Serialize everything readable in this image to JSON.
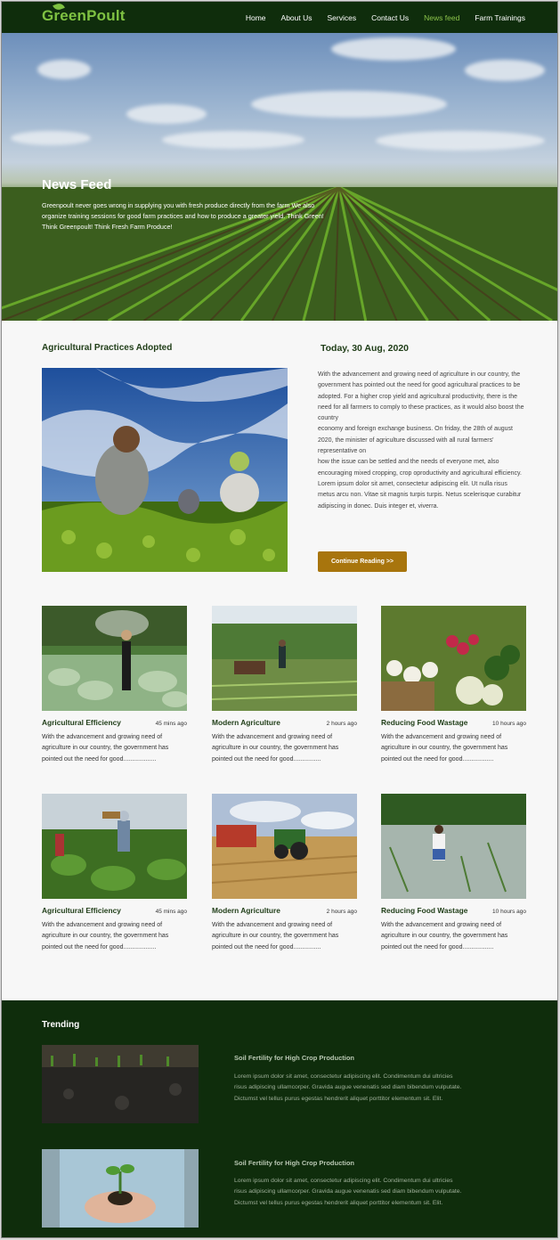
{
  "brand": {
    "name": "GreenPoult"
  },
  "nav": {
    "items": [
      "Home",
      "About Us",
      "Services",
      "Contact Us",
      "News feed",
      "Farm Trainings"
    ],
    "active": "News feed"
  },
  "hero": {
    "title": "News Feed",
    "text": "Greenpoult never goes wrong in supplying you with fresh produce directly from the farm We also organize training sessions for good farm practices and how to produce a greater yield.  Think Green! Think Greenpoult! Think Fresh Farm Produce!"
  },
  "featured": {
    "heading": "Agricultural Practices Adopted",
    "date": "Today, 30 Aug, 2020",
    "paragraphs": [
      "With the advancement and growing need of agriculture in our country, the government has pointed out the need for good agricultural practices to be",
      "adopted. For a higher crop yield and agricultural productivity, there is the need for all farmers to comply to these practices, as it would also boost the country",
      "economy and foreign exchange business. On friday, the 28th of august 2020, the minister of agriculture discussed with all rural farmers' representative on",
      "how the  issue can be settled and the needs of everyone met, also encouraging mixed cropping, crop oproductivity and agricultural efficiency.",
      "Lorem ipsum dolor sit amet, consectetur adipiscing elit. Ut nulla risus metus arcu non. Vitae sit magnis turpis turpis. Netus scelerisque curabitur adipiscing in donec. Duis integer et, viverra."
    ],
    "button": "Continue Reading >>"
  },
  "cards": [
    {
      "title": "Agricultural Efficiency",
      "time": "45 mins ago",
      "desc": "With the advancement and growing need of agriculture in our country, the government has pointed out the need for good..................."
    },
    {
      "title": "Modern Agriculture",
      "time": "2 hours ago",
      "desc": "With the advancement and growing need of agriculture in our country, the government has pointed out the need for good................"
    },
    {
      "title": "Reducing Food Wastage",
      "time": "10 hours ago",
      "desc": "With the advancement and growing need of agriculture in our country, the government has pointed out the need for good.................."
    },
    {
      "title": "Agricultural Efficiency",
      "time": "45 mins ago",
      "desc": "With the advancement and growing need of agriculture in our country, the government has pointed out the need for good..................."
    },
    {
      "title": "Modern Agriculture",
      "time": "2 hours ago",
      "desc": "With the advancement and growing need of agriculture in our country, the government has pointed out the need for good................"
    },
    {
      "title": "Reducing Food Wastage",
      "time": "10 hours ago",
      "desc": "With the advancement and growing need of agriculture in our country, the government has pointed out the need for good.................."
    }
  ],
  "trending": {
    "heading": "Trending",
    "items": [
      {
        "title": "Soil Fertility for High Crop Production",
        "text": "Lorem ipsum dolor sit amet, consectetur adipiscing elit. Condimentum dui ultricies risus adipiscing ullamcorper. Gravida augue venenatis sed diam bibendum vulputate. Dictumst vel tellus purus egestas hendrerit aliquet porttitor elementum sit. Elit."
      },
      {
        "title": "Soil Fertility for High Crop Production",
        "text": "Lorem ipsum dolor sit amet, consectetur adipiscing elit. Condimentum dui ultricies risus adipiscing ullamcorper. Gravida augue venenatis sed diam bibendum vulputate. Dictumst vel tellus purus egestas hendrerit aliquet porttitor elementum sit. Elit."
      }
    ]
  },
  "colors": {
    "header_bg": "#0f2d0c",
    "accent_green": "#7fc242",
    "button_gold": "#a8750d"
  }
}
